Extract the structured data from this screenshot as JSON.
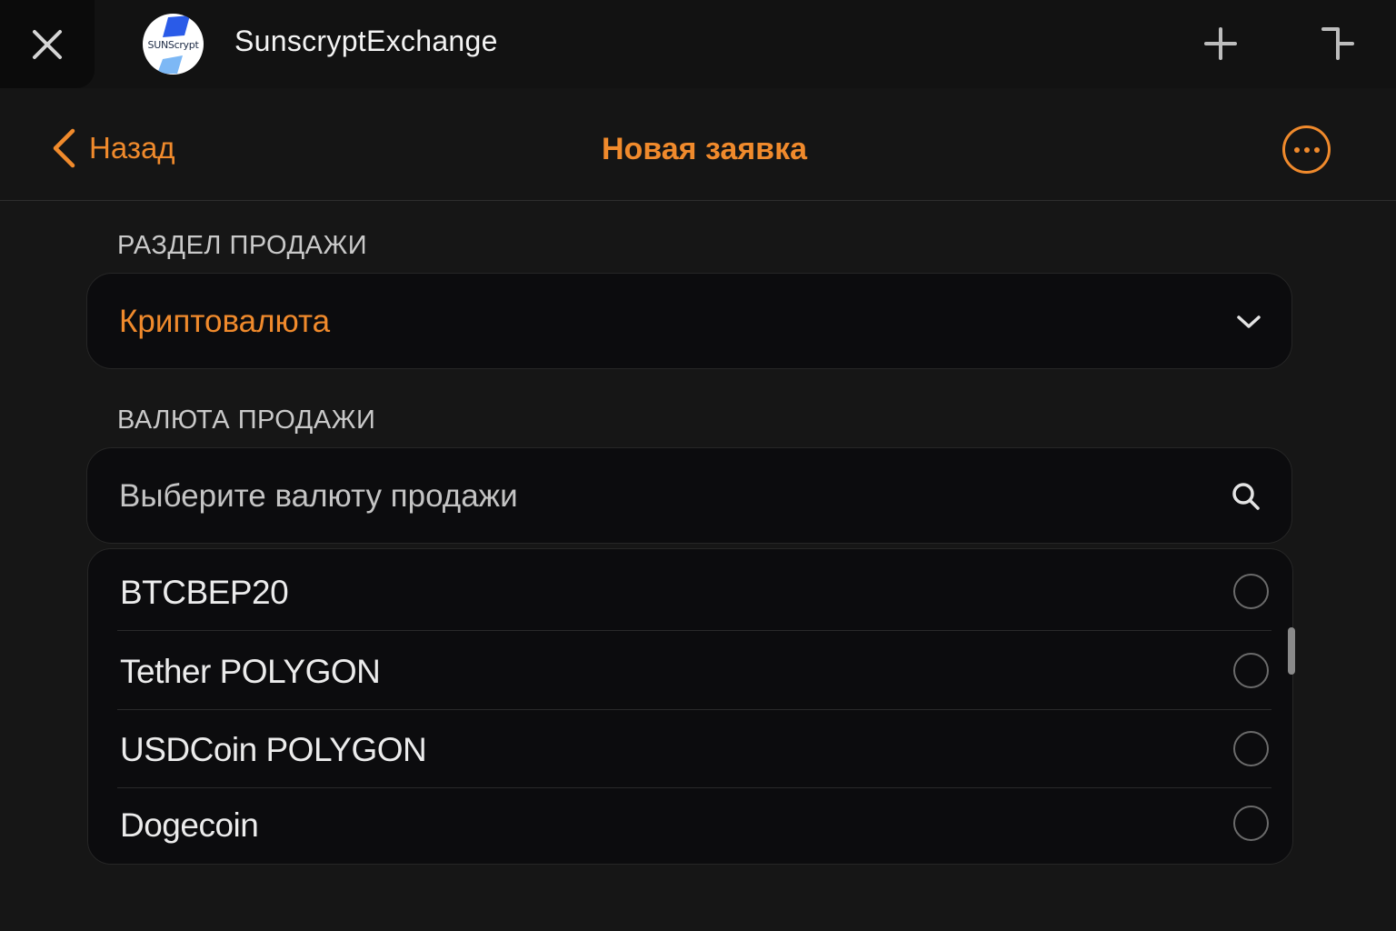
{
  "topbar": {
    "close_icon": "close-icon",
    "logo_text": "SUNScrypt",
    "app_title": "SunscryptExchange",
    "add_icon": "plus-icon",
    "corner_icon": "collapse-icon"
  },
  "navbar": {
    "back_label": "Назад",
    "title": "Новая заявка",
    "more_icon": "ellipsis-icon"
  },
  "form": {
    "sale_section_label": "РАЗДЕЛ ПРОДАЖИ",
    "sale_section_value": "Криптовалюта",
    "currency_section_label": "ВАЛЮТА ПРОДАЖИ",
    "currency_search_placeholder": "Выберите валюту продажи",
    "currencies": [
      {
        "label": "BTCBEP20",
        "selected": false
      },
      {
        "label": "Tether POLYGON",
        "selected": false
      },
      {
        "label": "USDCoin POLYGON",
        "selected": false
      },
      {
        "label": "Dogecoin",
        "selected": false
      }
    ]
  },
  "colors": {
    "accent": "#f08a2c",
    "background": "#161616",
    "field_background": "#0c0c0e"
  }
}
